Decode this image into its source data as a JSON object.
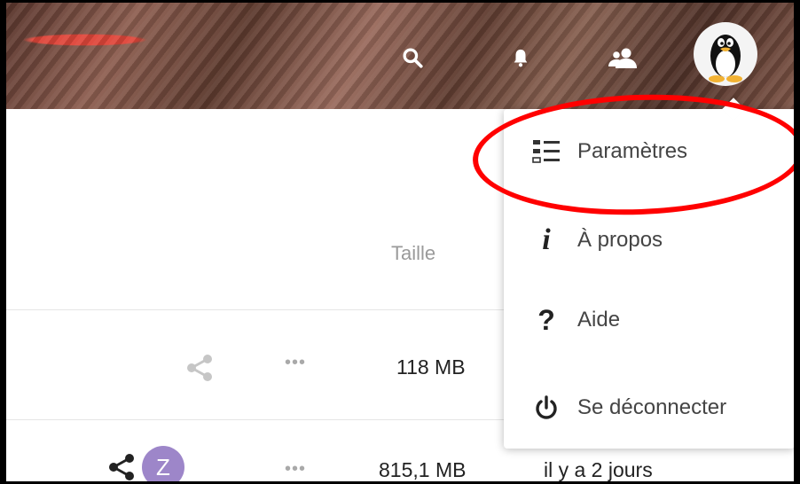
{
  "header": {
    "icons": [
      "search-icon",
      "bell-icon",
      "contacts-icon",
      "avatar"
    ]
  },
  "files": {
    "column_size_label": "Taille",
    "rows": [
      {
        "size": "118 MB",
        "date": ""
      },
      {
        "size": "815,1 MB",
        "date": "il y a 2 jours",
        "avatar_initial": "Z"
      }
    ]
  },
  "menu": {
    "items": [
      {
        "label": "Paramètres",
        "icon": "settings-list-icon"
      },
      {
        "label": "À propos",
        "icon": "info-icon"
      },
      {
        "label": "Aide",
        "icon": "help-icon"
      },
      {
        "label": "Se déconnecter",
        "icon": "power-icon"
      }
    ]
  },
  "colors": {
    "annotation": "#ff0000",
    "badge": "#9d86c9"
  }
}
